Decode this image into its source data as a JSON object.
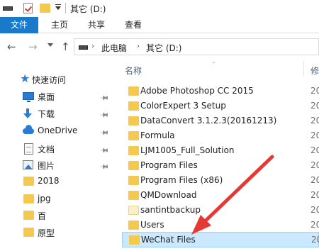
{
  "window": {
    "title": "其它 (D:)"
  },
  "ribbon": {
    "tabs": [
      {
        "label": "文件",
        "active": true
      },
      {
        "label": "主页"
      },
      {
        "label": "共享"
      },
      {
        "label": "查看"
      }
    ]
  },
  "address": {
    "segments": [
      "此电脑",
      "其它 (D:)"
    ]
  },
  "navpane": {
    "quick_access": "快速访问",
    "items": [
      {
        "label": "桌面",
        "icon": "desktop-icon",
        "pinned": true
      },
      {
        "label": "下载",
        "icon": "download-icon",
        "pinned": true
      },
      {
        "label": "OneDrive",
        "icon": "onedrive-icon",
        "pinned": true
      },
      {
        "label": "文档",
        "icon": "document-icon",
        "pinned": true
      },
      {
        "label": "图片",
        "icon": "picture-icon",
        "pinned": true
      },
      {
        "label": "2018",
        "icon": "folder-icon"
      },
      {
        "label": "jpg",
        "icon": "folder-icon"
      },
      {
        "label": "百",
        "icon": "folder-icon"
      },
      {
        "label": "原型",
        "icon": "folder-icon"
      }
    ]
  },
  "filelist": {
    "columns": {
      "name": "名称",
      "modified_partial": "修"
    },
    "rows": [
      {
        "name": "Adobe Photoshop CC 2015",
        "modified": "20"
      },
      {
        "name": "ColorExpert 3 Setup",
        "modified": "20"
      },
      {
        "name": "DataConvert 3.1.2.3(20161213)",
        "modified": "20"
      },
      {
        "name": "Formula",
        "modified": "20"
      },
      {
        "name": "LJM1005_Full_Solution",
        "modified": "20"
      },
      {
        "name": "Program Files",
        "modified": "20"
      },
      {
        "name": "Program Files (x86)",
        "modified": "20"
      },
      {
        "name": "QMDownload",
        "modified": "20"
      },
      {
        "name": "santintbackup",
        "modified": "20",
        "pale": true
      },
      {
        "name": "Users",
        "modified": "20"
      },
      {
        "name": "WeChat Files",
        "modified": "20",
        "selected": true
      }
    ]
  },
  "colors": {
    "accent": "#1979ca",
    "folder": "#f5c94e",
    "selection": "#cce8ff",
    "annotation_arrow": "#e53935"
  }
}
